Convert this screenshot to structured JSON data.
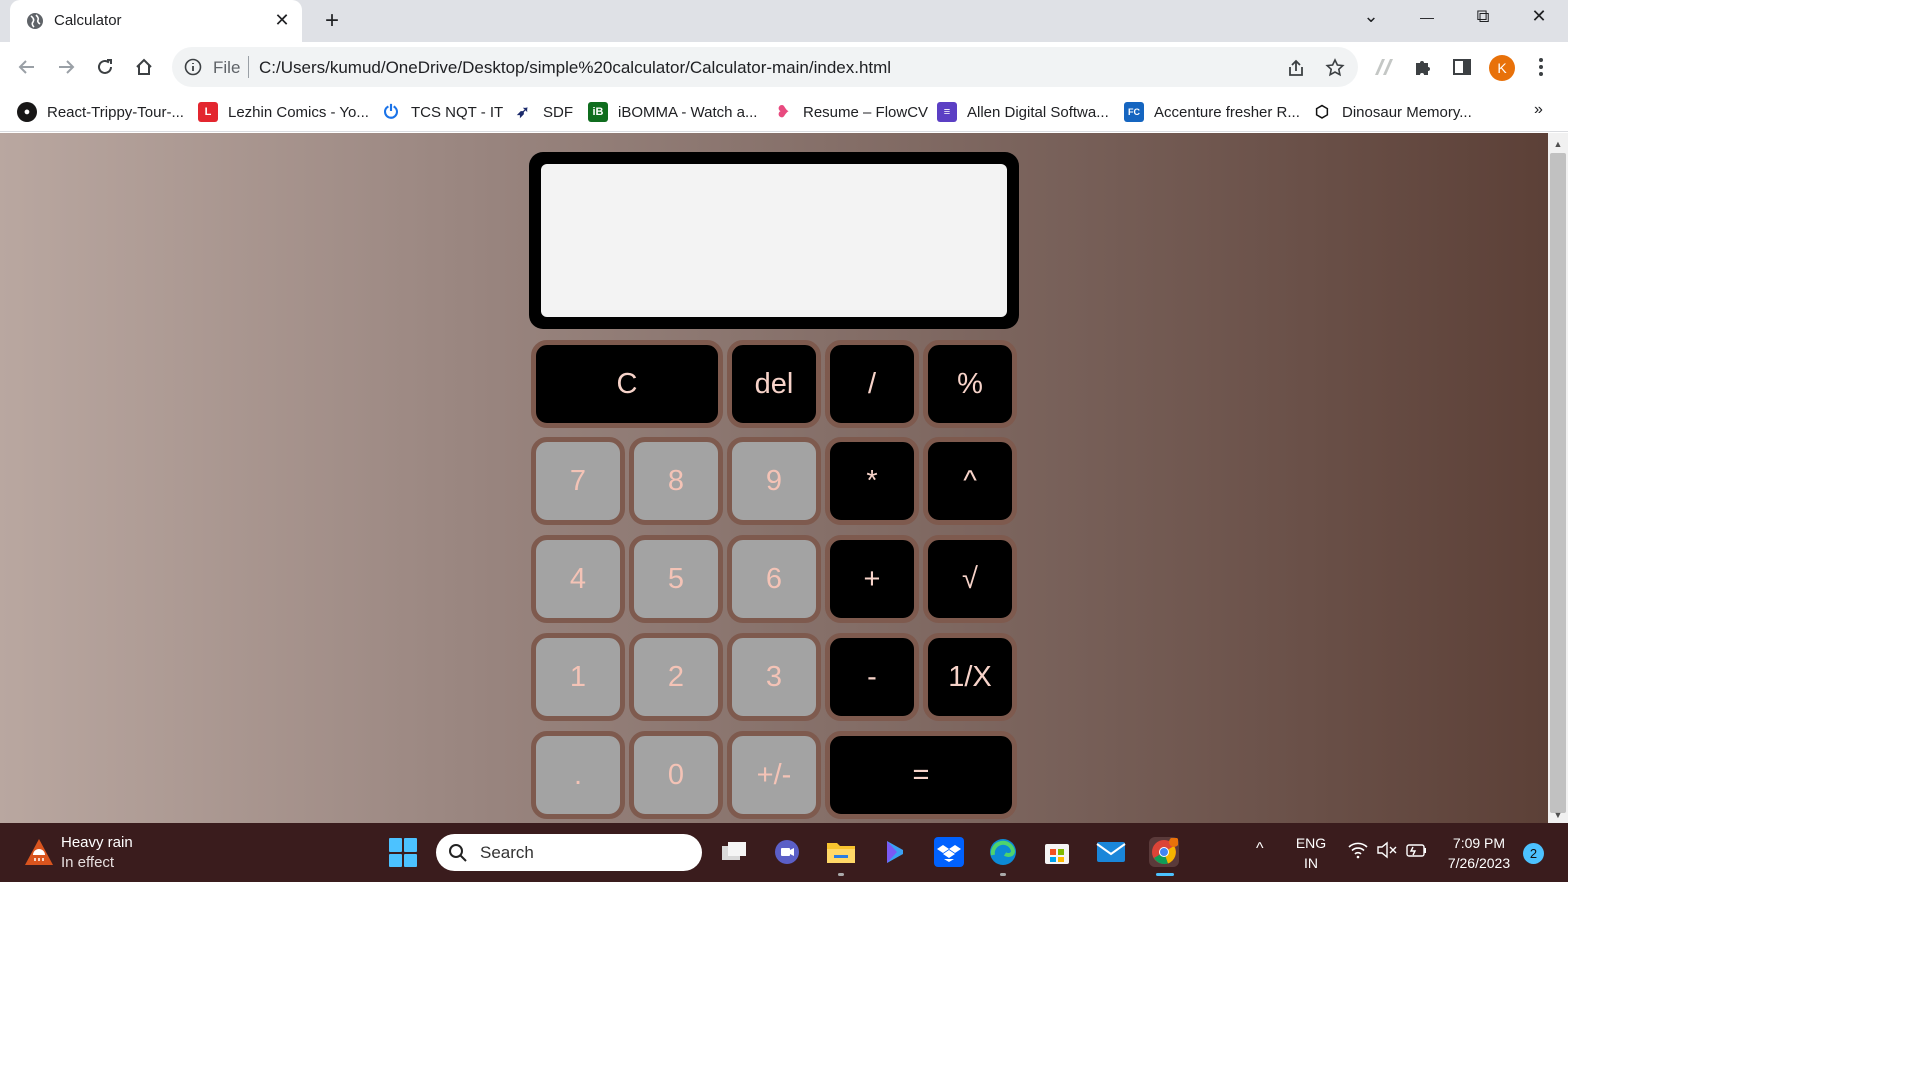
{
  "browser": {
    "tab_title": "Calculator",
    "tab_close": "✕",
    "new_tab": "+",
    "window_controls": {
      "dropdown": "⌄",
      "minimize": "—",
      "restore": "⧉",
      "close": "✕"
    },
    "address_prefix": "File",
    "url": "C:/Users/kumud/OneDrive/Desktop/simple%20calculator/Calculator-main/index.html",
    "profile_initial": "K",
    "bookmarks": [
      {
        "label": "React-Trippy-Tour-...",
        "icon": "github-icon"
      },
      {
        "label": "Lezhin Comics - Yo...",
        "icon": "lezhin-icon"
      },
      {
        "label": "TCS NQT - IT",
        "icon": "power-icon"
      },
      {
        "label": "SDF",
        "icon": "sdf-icon"
      },
      {
        "label": "iBOMMA - Watch a...",
        "icon": "ibomma-icon"
      },
      {
        "label": "Resume – FlowCV",
        "icon": "flowcv-icon"
      },
      {
        "label": "Allen Digital Softwa...",
        "icon": "allen-icon"
      },
      {
        "label": "Accenture fresher R...",
        "icon": "fc-icon"
      },
      {
        "label": "Dinosaur Memory...",
        "icon": "codepen-icon"
      }
    ],
    "bookmarks_more": "»"
  },
  "calculator": {
    "display_value": "",
    "keys": [
      {
        "label": "C",
        "kind": "op"
      },
      {
        "label": "del",
        "kind": "op"
      },
      {
        "label": "/",
        "kind": "op"
      },
      {
        "label": "%",
        "kind": "op"
      },
      {
        "label": "7",
        "kind": "num"
      },
      {
        "label": "8",
        "kind": "num"
      },
      {
        "label": "9",
        "kind": "num"
      },
      {
        "label": "*",
        "kind": "op"
      },
      {
        "label": "^",
        "kind": "op"
      },
      {
        "label": "4",
        "kind": "num"
      },
      {
        "label": "5",
        "kind": "num"
      },
      {
        "label": "6",
        "kind": "num"
      },
      {
        "label": "+",
        "kind": "op"
      },
      {
        "label": "√",
        "kind": "op"
      },
      {
        "label": "1",
        "kind": "num"
      },
      {
        "label": "2",
        "kind": "num"
      },
      {
        "label": "3",
        "kind": "num"
      },
      {
        "label": "-",
        "kind": "op"
      },
      {
        "label": "1/X",
        "kind": "op"
      },
      {
        "label": ".",
        "kind": "num"
      },
      {
        "label": "0",
        "kind": "num"
      },
      {
        "label": "+/-",
        "kind": "num"
      },
      {
        "label": "=",
        "kind": "op"
      }
    ]
  },
  "taskbar": {
    "weather_title": "Heavy rain",
    "weather_status": "In effect",
    "search_placeholder": "Search",
    "language": "ENG",
    "region": "IN",
    "time": "7:09 PM",
    "date": "7/26/2023",
    "notification_count": "2",
    "tray_chevron": "^",
    "apps": [
      "task-view-icon",
      "teams-icon",
      "file-explorer-icon",
      "copilot-icon",
      "dropbox-icon",
      "edge-icon",
      "store-icon",
      "mail-icon",
      "chrome-icon"
    ]
  }
}
